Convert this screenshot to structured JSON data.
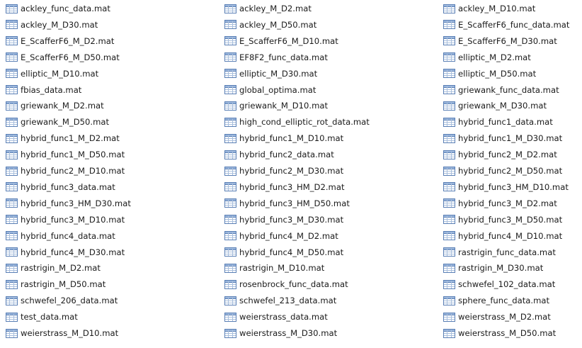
{
  "file_icon": "mat-file-table-icon",
  "columns": [
    {
      "files": [
        "ackley_func_data.mat",
        "ackley_M_D30.mat",
        "E_ScafferF6_M_D2.mat",
        "E_ScafferF6_M_D50.mat",
        "elliptic_M_D10.mat",
        "fbias_data.mat",
        "griewank_M_D2.mat",
        "griewank_M_D50.mat",
        "hybrid_func1_M_D2.mat",
        "hybrid_func1_M_D50.mat",
        "hybrid_func2_M_D10.mat",
        "hybrid_func3_data.mat",
        "hybrid_func3_HM_D30.mat",
        "hybrid_func3_M_D10.mat",
        "hybrid_func4_data.mat",
        "hybrid_func4_M_D30.mat",
        "rastrigin_M_D2.mat",
        "rastrigin_M_D50.mat",
        "schwefel_206_data.mat",
        "test_data.mat",
        "weierstrass_M_D10.mat"
      ]
    },
    {
      "files": [
        "ackley_M_D2.mat",
        "ackley_M_D50.mat",
        "E_ScafferF6_M_D10.mat",
        "EF8F2_func_data.mat",
        "elliptic_M_D30.mat",
        "global_optima.mat",
        "griewank_M_D10.mat",
        "high_cond_elliptic_rot_data.mat",
        "hybrid_func1_M_D10.mat",
        "hybrid_func2_data.mat",
        "hybrid_func2_M_D30.mat",
        "hybrid_func3_HM_D2.mat",
        "hybrid_func3_HM_D50.mat",
        "hybrid_func3_M_D30.mat",
        "hybrid_func4_M_D2.mat",
        "hybrid_func4_M_D50.mat",
        "rastrigin_M_D10.mat",
        "rosenbrock_func_data.mat",
        "schwefel_213_data.mat",
        "weierstrass_data.mat",
        "weierstrass_M_D30.mat"
      ]
    },
    {
      "files": [
        "ackley_M_D10.mat",
        "E_ScafferF6_func_data.mat",
        "E_ScafferF6_M_D30.mat",
        "elliptic_M_D2.mat",
        "elliptic_M_D50.mat",
        "griewank_func_data.mat",
        "griewank_M_D30.mat",
        "hybrid_func1_data.mat",
        "hybrid_func1_M_D30.mat",
        "hybrid_func2_M_D2.mat",
        "hybrid_func2_M_D50.mat",
        "hybrid_func3_HM_D10.mat",
        "hybrid_func3_M_D2.mat",
        "hybrid_func3_M_D50.mat",
        "hybrid_func4_M_D10.mat",
        "rastrigin_func_data.mat",
        "rastrigin_M_D30.mat",
        "schwefel_102_data.mat",
        "sphere_func_data.mat",
        "weierstrass_M_D2.mat",
        "weierstrass_M_D50.mat"
      ]
    }
  ]
}
